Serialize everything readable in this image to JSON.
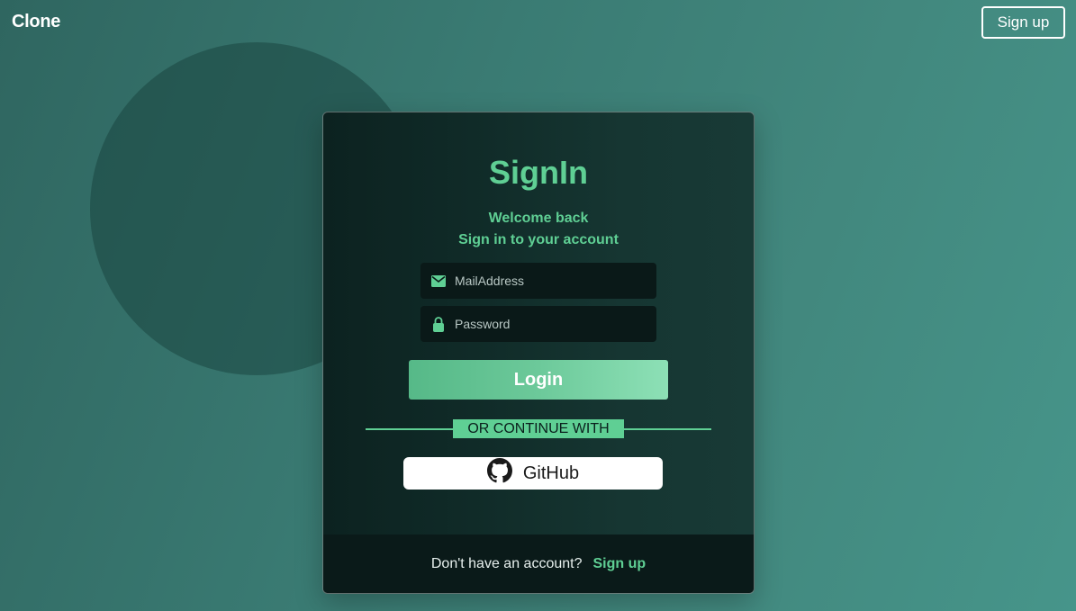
{
  "header": {
    "brand": "Clone",
    "signup_label": "Sign up"
  },
  "card": {
    "title": "SignIn",
    "welcome_line1": "Welcome back",
    "welcome_line2": "Sign in to your account",
    "email_placeholder": "MailAddress",
    "password_placeholder": "Password",
    "login_label": "Login",
    "divider_label": "OR CONTINUE WITH",
    "github_label": "GitHub",
    "footer_text": "Don't have an account?",
    "footer_link": "Sign up"
  },
  "icons": {
    "email": "mail-icon",
    "password": "lock-icon",
    "github": "github-icon"
  },
  "colors": {
    "accent": "#5fcf94",
    "card_bg": "#102b28"
  }
}
